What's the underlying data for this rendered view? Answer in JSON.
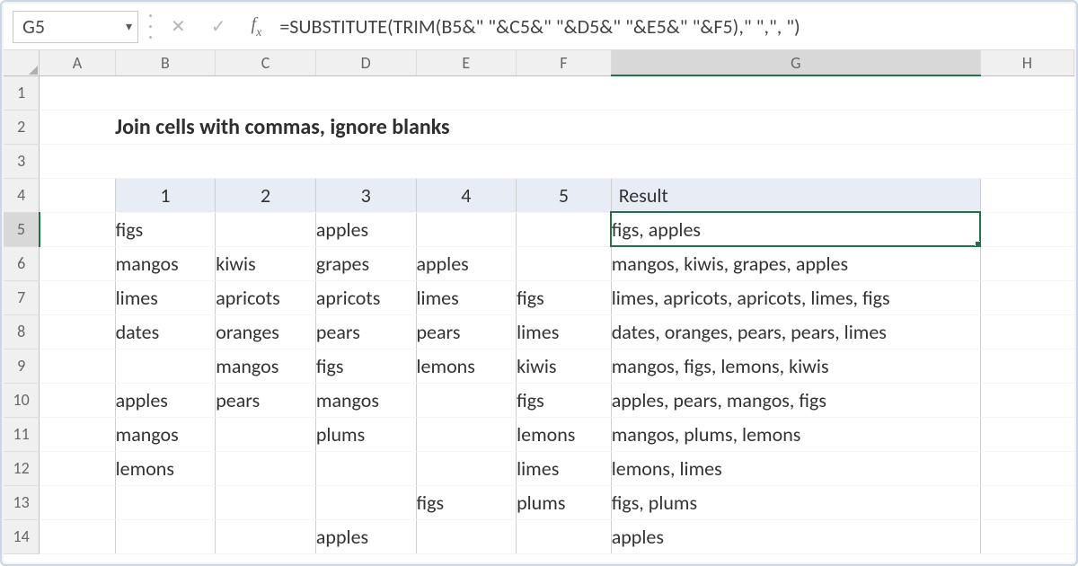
{
  "namebox": {
    "value": "G5"
  },
  "formula_bar": {
    "value": "=SUBSTITUTE(TRIM(B5&\" \"&C5&\" \"&D5&\" \"&E5&\" \"&F5),\" \",\", \")"
  },
  "columns": [
    "A",
    "B",
    "C",
    "D",
    "E",
    "F",
    "G",
    "H"
  ],
  "selected_column": "G",
  "row_headers": [
    "1",
    "2",
    "3",
    "4",
    "5",
    "6",
    "7",
    "8",
    "9",
    "10",
    "11",
    "12",
    "13",
    "14"
  ],
  "selected_row": "5",
  "title_cell": "Join cells with commas, ignore blanks",
  "table": {
    "headers": [
      "1",
      "2",
      "3",
      "4",
      "5",
      "Result"
    ],
    "rows": [
      {
        "c": [
          "figs",
          "",
          "apples",
          "",
          ""
        ],
        "r": "figs, apples"
      },
      {
        "c": [
          "mangos",
          "kiwis",
          "grapes",
          "apples",
          ""
        ],
        "r": "mangos, kiwis, grapes, apples"
      },
      {
        "c": [
          "limes",
          "apricots",
          "apricots",
          "limes",
          "figs"
        ],
        "r": "limes, apricots, apricots, limes, figs"
      },
      {
        "c": [
          "dates",
          "oranges",
          "pears",
          "pears",
          "limes"
        ],
        "r": "dates, oranges, pears, pears, limes"
      },
      {
        "c": [
          "",
          "mangos",
          "figs",
          "lemons",
          "kiwis"
        ],
        "r": "mangos, figs, lemons, kiwis"
      },
      {
        "c": [
          "apples",
          "pears",
          "mangos",
          "",
          "figs"
        ],
        "r": "apples, pears, mangos, figs"
      },
      {
        "c": [
          "mangos",
          "",
          "plums",
          "",
          "lemons"
        ],
        "r": "mangos, plums, lemons"
      },
      {
        "c": [
          "lemons",
          "",
          "",
          "",
          "limes"
        ],
        "r": "lemons, limes"
      },
      {
        "c": [
          "",
          "",
          "",
          "figs",
          "plums"
        ],
        "r": "figs, plums"
      },
      {
        "c": [
          "",
          "",
          "apples",
          "",
          ""
        ],
        "r": "apples"
      }
    ]
  }
}
